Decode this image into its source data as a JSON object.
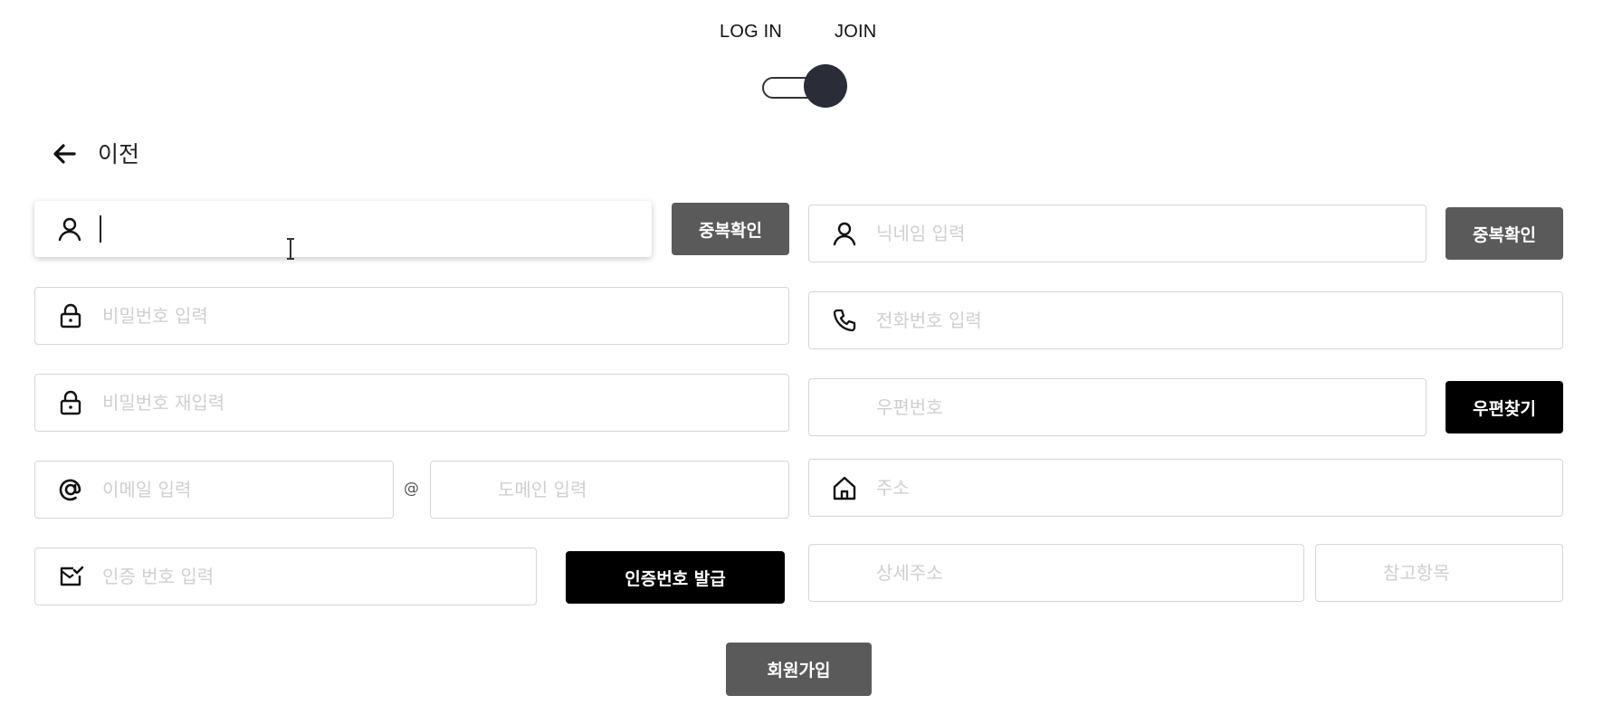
{
  "auth_switch": {
    "login_label": "LOG IN",
    "join_label": "JOIN",
    "state": "join"
  },
  "back": {
    "label": "이전",
    "icon": "arrow-left-icon"
  },
  "left": {
    "id_field": {
      "icon": "user-icon",
      "value": "",
      "placeholder": ""
    },
    "id_check_button": "중복확인",
    "password_field": {
      "icon": "lock-icon",
      "placeholder": "비밀번호 입력"
    },
    "password_confirm_field": {
      "icon": "lock-icon",
      "placeholder": "비밀번호 재입력"
    },
    "email_local_field": {
      "icon": "at-icon",
      "placeholder": "이메일 입력"
    },
    "email_separator": "@",
    "email_domain_field": {
      "placeholder": "도메인 입력"
    },
    "verify_field": {
      "icon": "mail-check-icon",
      "placeholder": "인증 번호 입력"
    },
    "verify_button": "인증번호 발급"
  },
  "right": {
    "nickname_field": {
      "icon": "user-icon",
      "placeholder": "닉네임 입력"
    },
    "nickname_check_button": "중복확인",
    "phone_field": {
      "icon": "phone-icon",
      "placeholder": "전화번호 입력"
    },
    "postcode_field": {
      "placeholder": "우편번호"
    },
    "postcode_button": "우편찾기",
    "address_field": {
      "icon": "home-icon",
      "placeholder": "주소"
    },
    "address_detail_field": {
      "placeholder": "상세주소"
    },
    "address_extra_field": {
      "placeholder": "참고항목"
    }
  },
  "submit_button": "회원가입",
  "colors": {
    "primary_button": "#5a5a5a",
    "accent_button": "#000000",
    "knob": "#2a2c37",
    "placeholder": "#cfcfcf"
  }
}
